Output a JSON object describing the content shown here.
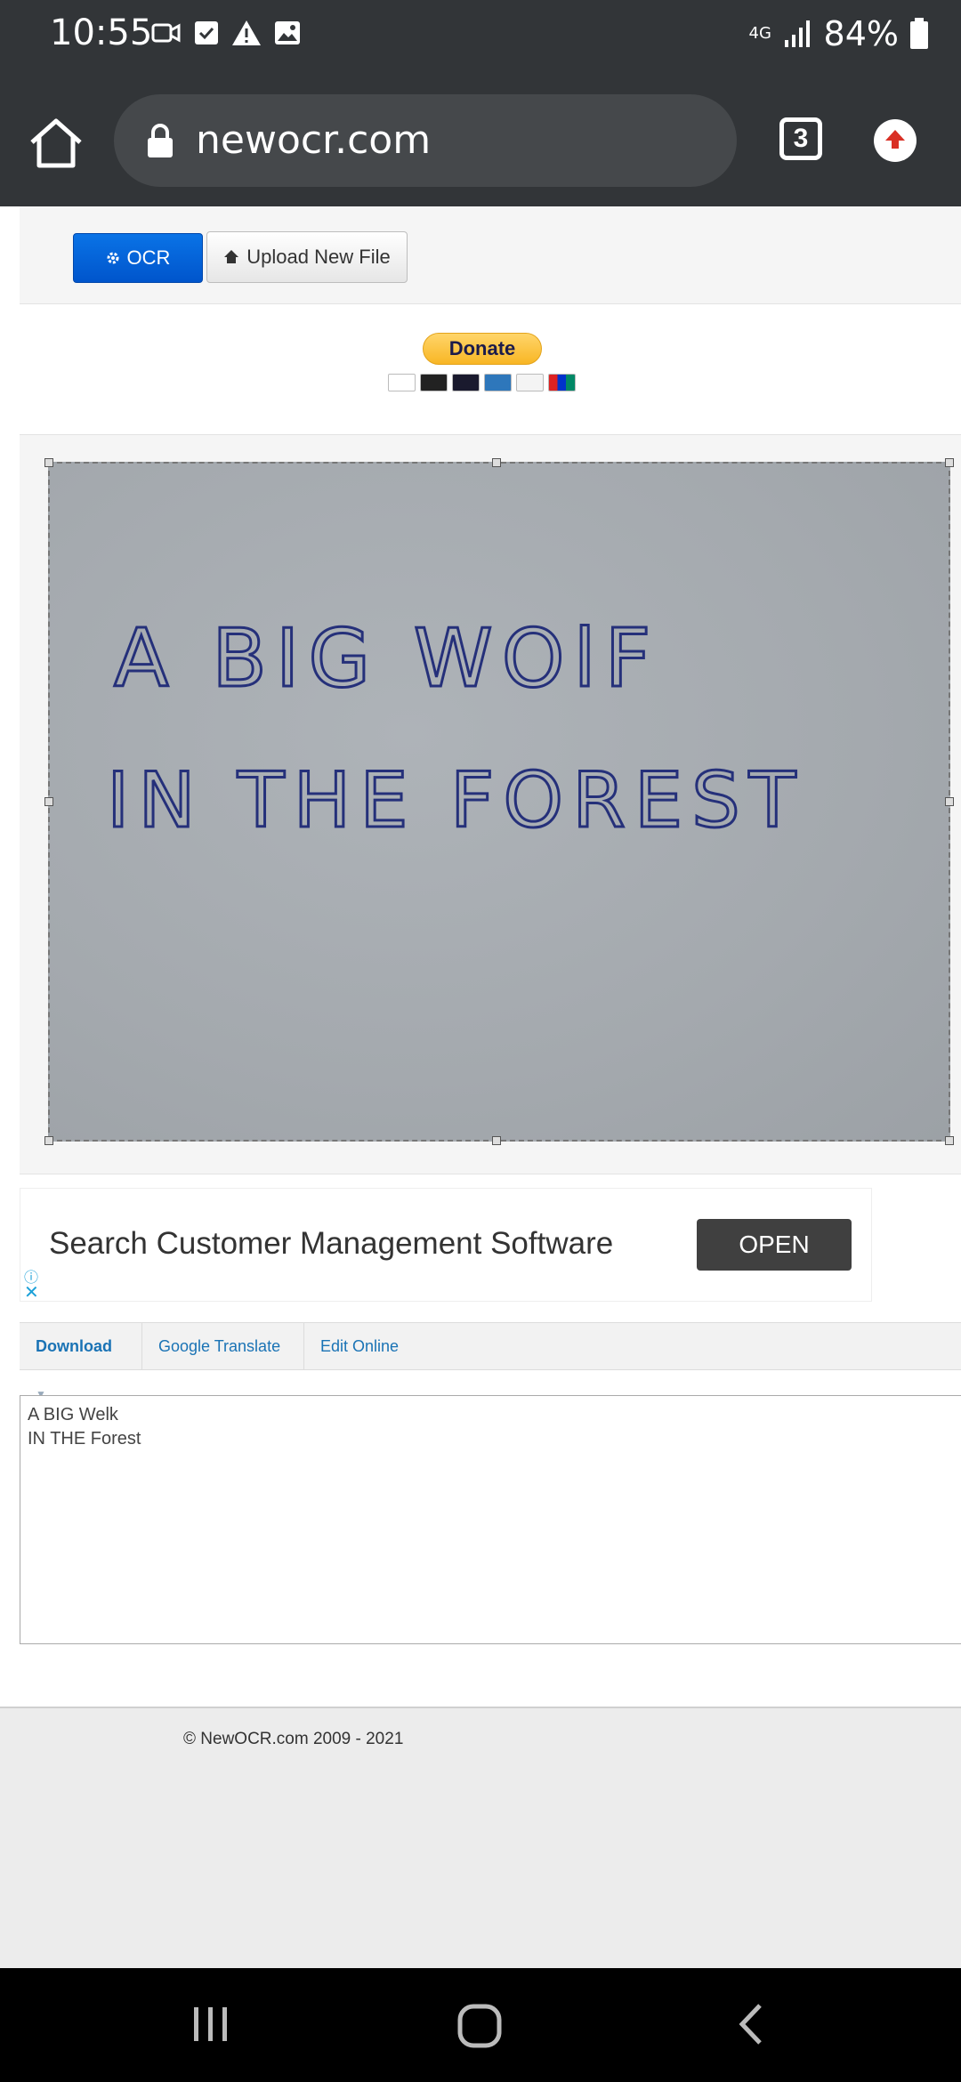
{
  "status_bar": {
    "time": "10:55",
    "network": "4G",
    "battery": "84%"
  },
  "browser": {
    "url": "newocr.com",
    "tab_count": "3"
  },
  "toolbar": {
    "ocr_label": "OCR",
    "upload_label": "Upload New File"
  },
  "donate": {
    "label": "Donate"
  },
  "image": {
    "handwritten_line1": "A BIG WOlF",
    "handwritten_line2": "IN THE FOREST"
  },
  "ad": {
    "text": "Search Customer Management Software",
    "button": "OPEN"
  },
  "result_tabs": {
    "download": "Download",
    "translate": "Google Translate",
    "edit": "Edit Online"
  },
  "output": {
    "line1": "A BIG Welk",
    "line2": "IN THE Forest"
  },
  "footer": {
    "copyright": "© NewOCR.com 2009 - 2021"
  },
  "colors": {
    "primary": "#0066dd",
    "link": "#1a73b5",
    "chrome": "#323538"
  }
}
